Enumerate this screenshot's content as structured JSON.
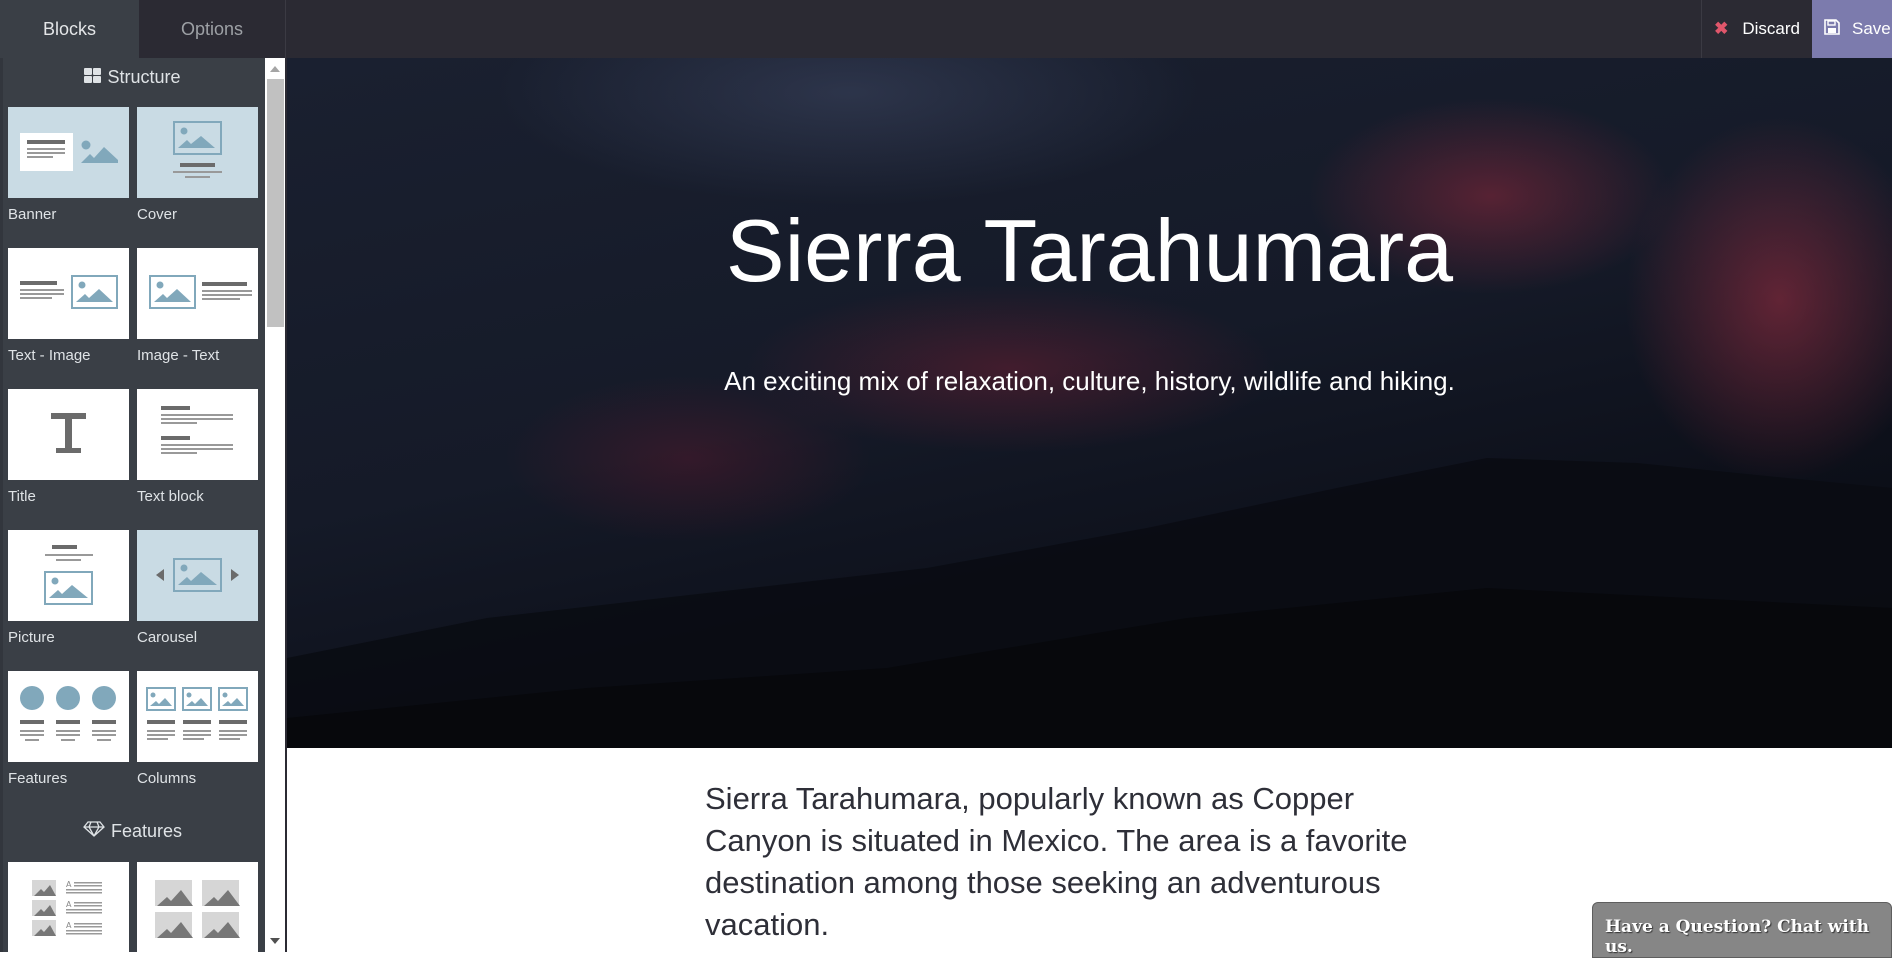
{
  "topbar": {
    "tabs": [
      {
        "label": "Blocks",
        "active": true
      },
      {
        "label": "Options",
        "active": false
      }
    ],
    "discard_label": "Discard",
    "discard_icon": "close-icon",
    "save_label": "Save",
    "save_icon": "floppy-disk-icon",
    "colors": {
      "bar": "#2b2a33",
      "save": "#7c7bad",
      "discard_icon": "#e0566b"
    }
  },
  "sidebar": {
    "sections": [
      {
        "title": "Structure",
        "icon": "grid-icon",
        "blocks": [
          {
            "label": "Banner",
            "thumb": "banner"
          },
          {
            "label": "Cover",
            "thumb": "cover"
          },
          {
            "label": "Text - Image",
            "thumb": "text-image"
          },
          {
            "label": "Image - Text",
            "thumb": "image-text"
          },
          {
            "label": "Title",
            "thumb": "title"
          },
          {
            "label": "Text block",
            "thumb": "text-block"
          },
          {
            "label": "Picture",
            "thumb": "picture"
          },
          {
            "label": "Carousel",
            "thumb": "carousel"
          },
          {
            "label": "Features",
            "thumb": "features"
          },
          {
            "label": "Columns",
            "thumb": "columns"
          }
        ]
      },
      {
        "title": "Features",
        "icon": "diamond-icon",
        "blocks": [
          {
            "label": "",
            "thumb": "media-list"
          },
          {
            "label": "",
            "thumb": "image-gallery"
          }
        ]
      }
    ]
  },
  "hero": {
    "title": "Sierra Tarahumara",
    "subtitle": "An exciting mix of relaxation, culture, history, wildlife and hiking."
  },
  "content": {
    "intro": "Sierra Tarahumara, popularly known as Copper Canyon is situated in Mexico. The area is a favorite destination among those seeking an adventurous vacation."
  },
  "chat": {
    "label": "Have a Question? Chat with us."
  }
}
